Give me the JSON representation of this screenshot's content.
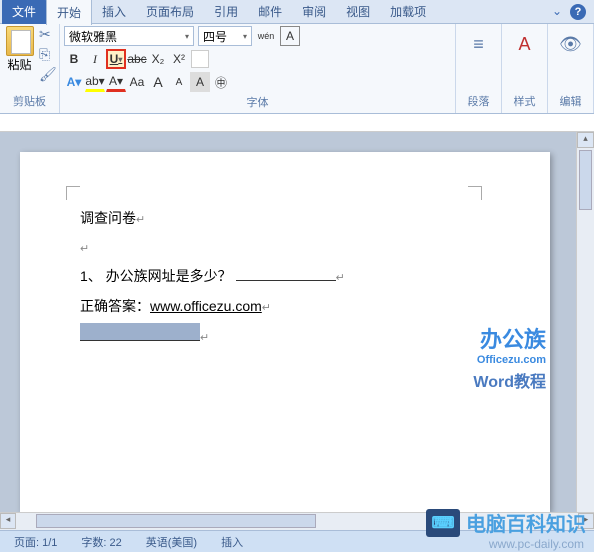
{
  "tabs": {
    "file": "文件",
    "home": "开始",
    "insert": "插入",
    "layout": "页面布局",
    "references": "引用",
    "mail": "邮件",
    "review": "审阅",
    "view": "视图",
    "addins": "加载项"
  },
  "ribbon": {
    "clipboard": {
      "paste": "粘贴",
      "group_label": "剪贴板"
    },
    "font": {
      "name": "微软雅黑",
      "size": "四号",
      "group_label": "字体",
      "bold": "B",
      "italic": "I",
      "underline": "U",
      "strike": "abc",
      "sub": "X₂",
      "sup": "X²",
      "aa": "Aa",
      "a_grow": "A",
      "a_shrink": "A",
      "char_border": "A",
      "pinyin": "wén",
      "enclose": "A",
      "clear": "◇"
    },
    "paragraph": {
      "label": "段落"
    },
    "styles": {
      "label": "样式"
    },
    "editing": {
      "label": "编辑"
    }
  },
  "document": {
    "title": "调查问卷",
    "q1": "1、 办公族网址是多少？",
    "answer_label": "正确答案：",
    "answer_url": "www.officezu.com"
  },
  "statusbar": {
    "page": "页面: 1/1",
    "words": "字数: 22",
    "lang": "英语(美国)",
    "insert": "插入"
  },
  "watermark": {
    "brand": "办公族",
    "brand_url": "Officezu.com",
    "tutorial": "Word教程",
    "site_name": "电脑百科知识",
    "site_url": "www.pc-daily.com"
  }
}
